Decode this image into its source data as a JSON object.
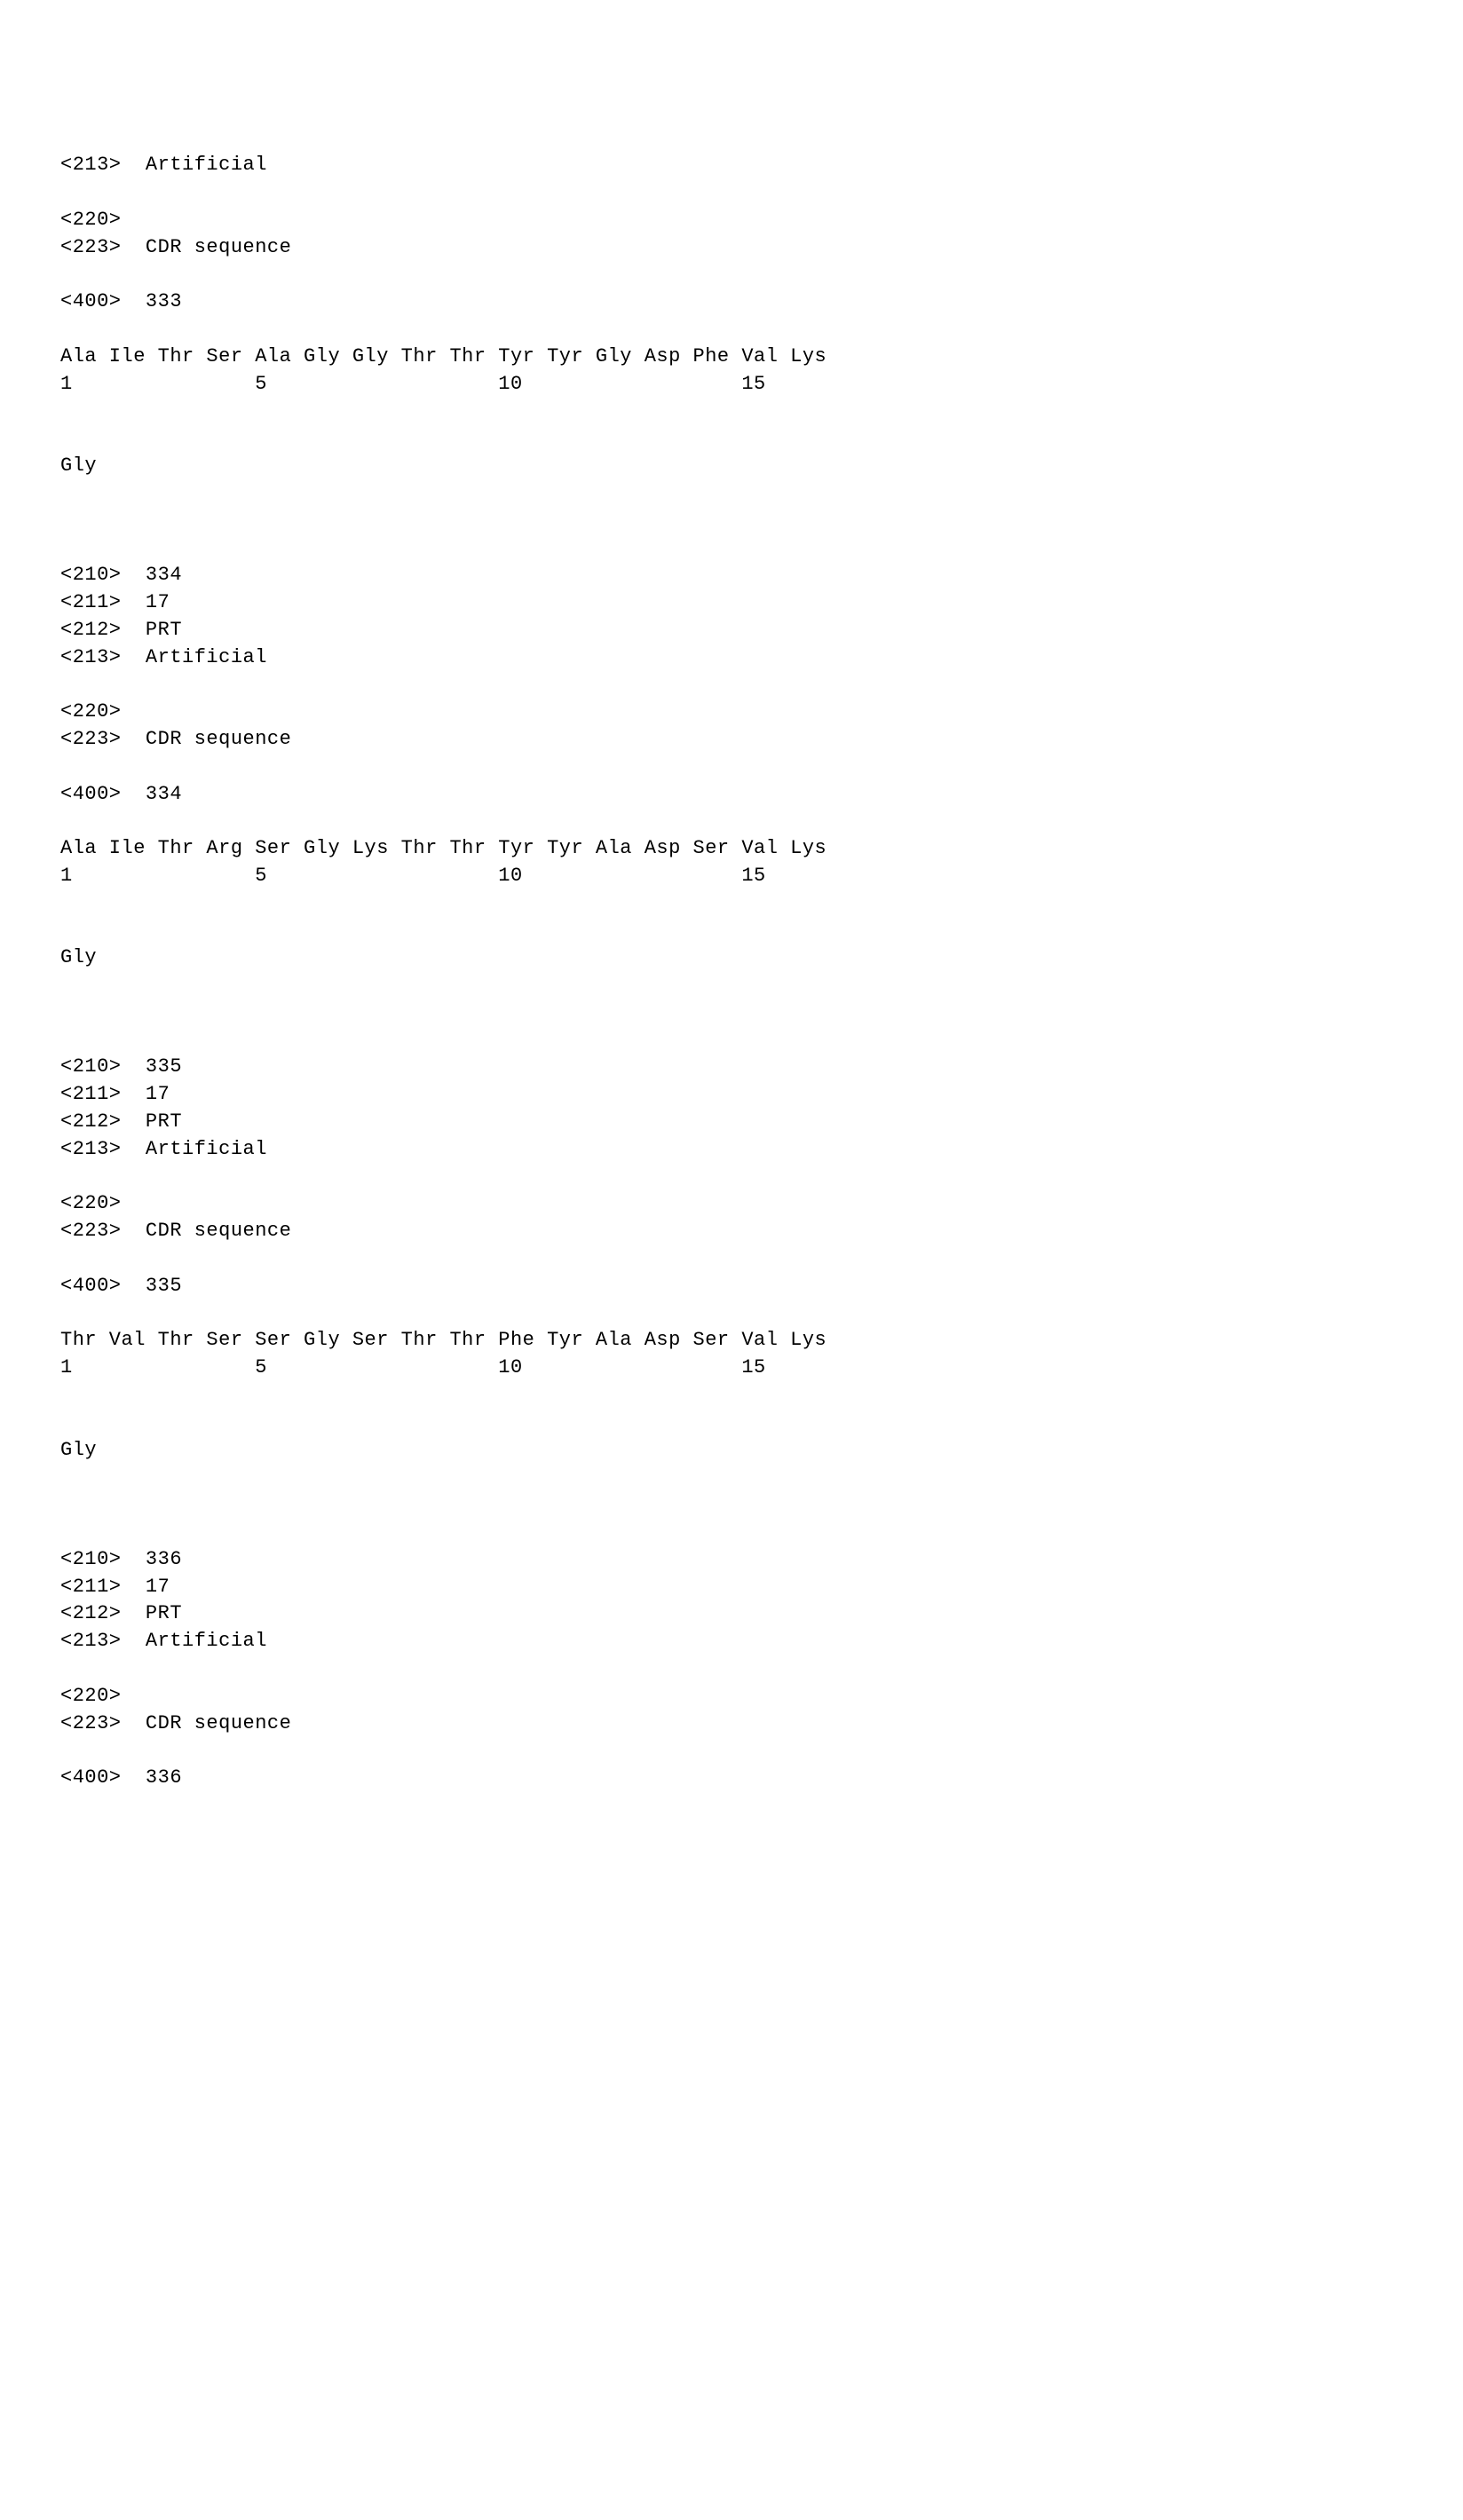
{
  "entries": [
    {
      "header_top": [
        {
          "tag": "<213>",
          "val": "Artificial"
        }
      ],
      "header_mid": [
        {
          "tag": "<220>",
          "val": ""
        },
        {
          "tag": "<223>",
          "val": "CDR sequence"
        }
      ],
      "header_400": {
        "tag": "<400>",
        "val": "333"
      },
      "seq_row1": "Ala Ile Thr Ser Ala Gly Gly Thr Thr Tyr Tyr Gly Asp Phe Val Lys",
      "num_row1": "1               5                   10                  15",
      "seq_row2": "Gly"
    },
    {
      "header_top": [
        {
          "tag": "<210>",
          "val": "334"
        },
        {
          "tag": "<211>",
          "val": "17"
        },
        {
          "tag": "<212>",
          "val": "PRT"
        },
        {
          "tag": "<213>",
          "val": "Artificial"
        }
      ],
      "header_mid": [
        {
          "tag": "<220>",
          "val": ""
        },
        {
          "tag": "<223>",
          "val": "CDR sequence"
        }
      ],
      "header_400": {
        "tag": "<400>",
        "val": "334"
      },
      "seq_row1": "Ala Ile Thr Arg Ser Gly Lys Thr Thr Tyr Tyr Ala Asp Ser Val Lys",
      "num_row1": "1               5                   10                  15",
      "seq_row2": "Gly"
    },
    {
      "header_top": [
        {
          "tag": "<210>",
          "val": "335"
        },
        {
          "tag": "<211>",
          "val": "17"
        },
        {
          "tag": "<212>",
          "val": "PRT"
        },
        {
          "tag": "<213>",
          "val": "Artificial"
        }
      ],
      "header_mid": [
        {
          "tag": "<220>",
          "val": ""
        },
        {
          "tag": "<223>",
          "val": "CDR sequence"
        }
      ],
      "header_400": {
        "tag": "<400>",
        "val": "335"
      },
      "seq_row1": "Thr Val Thr Ser Ser Gly Ser Thr Thr Phe Tyr Ala Asp Ser Val Lys",
      "num_row1": "1               5                   10                  15",
      "seq_row2": "Gly"
    },
    {
      "header_top": [
        {
          "tag": "<210>",
          "val": "336"
        },
        {
          "tag": "<211>",
          "val": "17"
        },
        {
          "tag": "<212>",
          "val": "PRT"
        },
        {
          "tag": "<213>",
          "val": "Artificial"
        }
      ],
      "header_mid": [
        {
          "tag": "<220>",
          "val": ""
        },
        {
          "tag": "<223>",
          "val": "CDR sequence"
        }
      ],
      "header_400": {
        "tag": "<400>",
        "val": "336"
      },
      "seq_row1": null,
      "num_row1": null,
      "seq_row2": null
    }
  ]
}
